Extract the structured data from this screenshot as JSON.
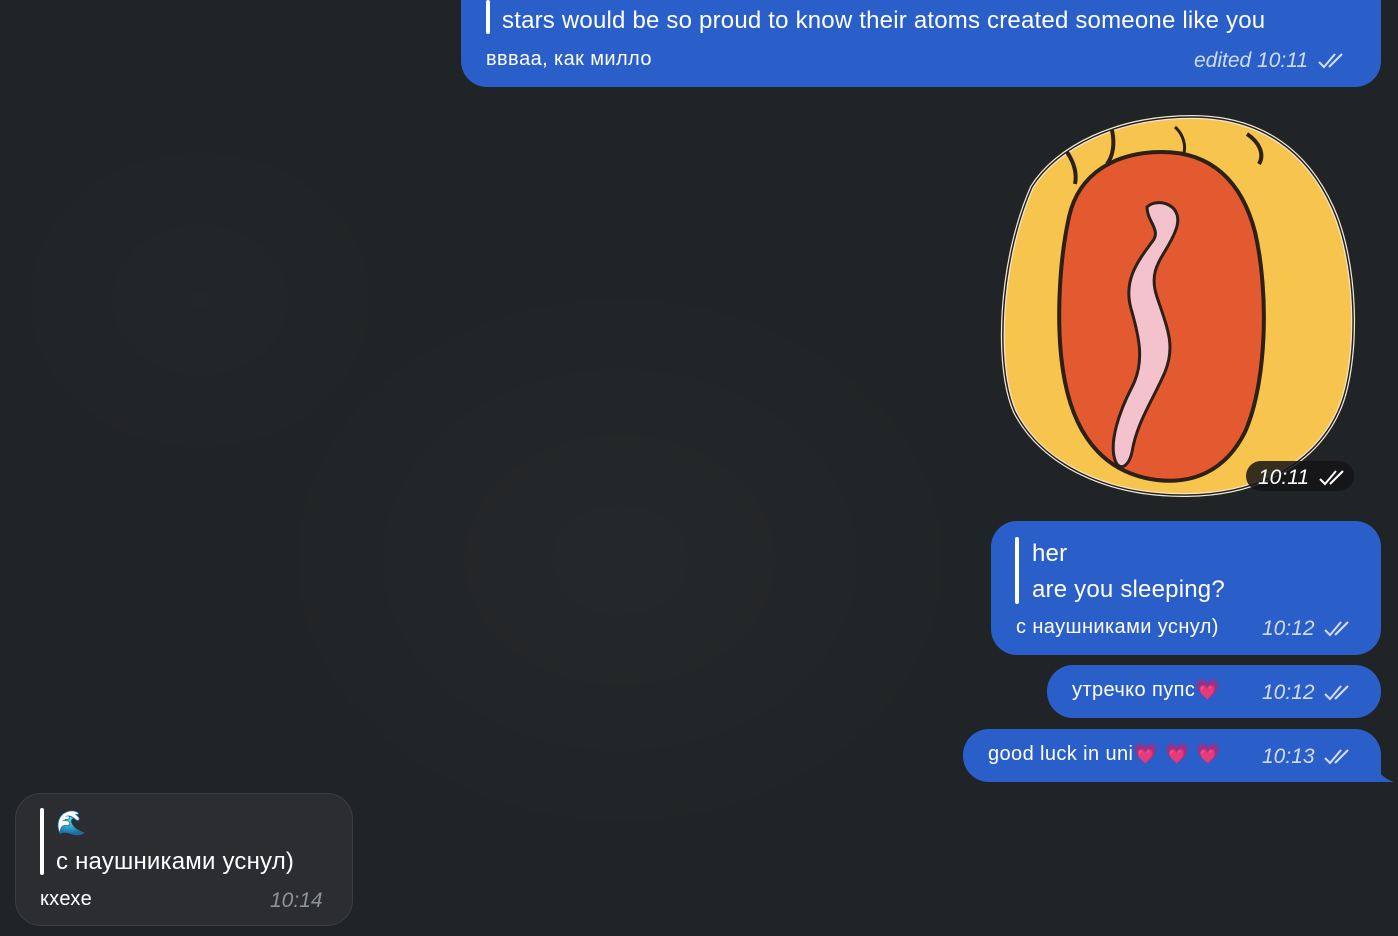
{
  "messages": [
    {
      "id": "m1",
      "quoted": "stars would be so proud to know their atoms created someone like you",
      "text": "вввaa, как милло",
      "meta": "edited 10:11"
    },
    {
      "id": "sticker",
      "meta": "10:11",
      "icon": "sticker-image"
    },
    {
      "id": "m3",
      "quoted_author": "her",
      "quoted": "are you sleeping?",
      "text": "с наушниками уснул)",
      "meta": "10:12"
    },
    {
      "id": "m4",
      "text": "утречко пупс",
      "emoji": "💗",
      "meta": "10:12"
    },
    {
      "id": "m5",
      "text": "good luck in uni",
      "emoji": "💗 💗 💗",
      "meta": "10:13"
    },
    {
      "id": "m6",
      "quoted_emoji": "🌊",
      "quoted": "с наушниками уснул)",
      "text": "кхехе",
      "meta": "10:14"
    }
  ],
  "colors": {
    "outgoing_bubble": "#2a5fc9",
    "incoming_bubble": "#2b2d30",
    "background": "#212426"
  }
}
